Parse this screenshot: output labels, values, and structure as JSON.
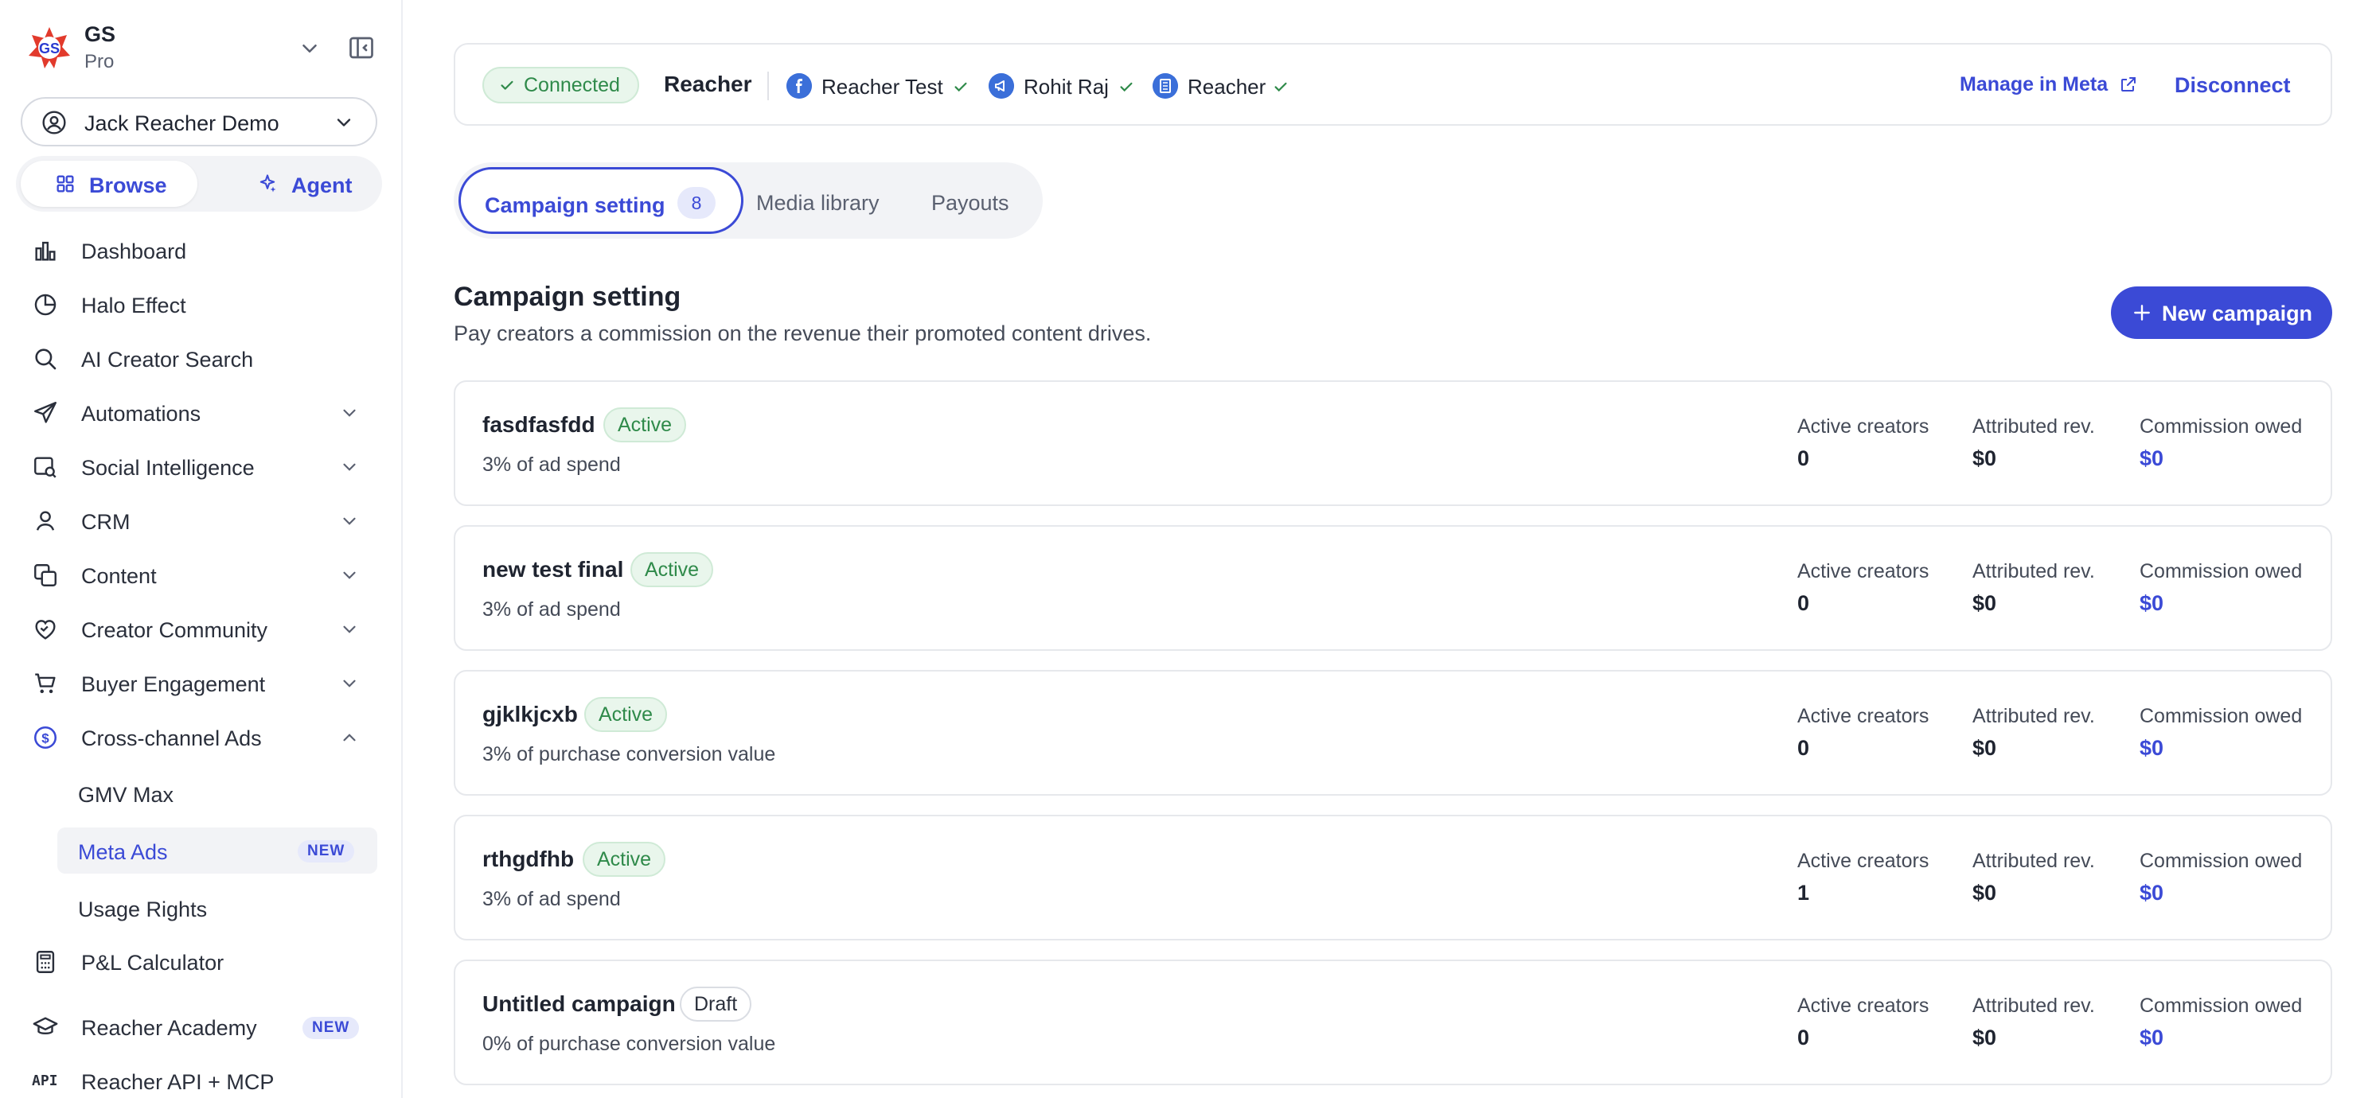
{
  "workspace": {
    "logo_text": "GS",
    "name": "GS",
    "plan": "Pro"
  },
  "user_select": {
    "label": "Jack Reacher Demo"
  },
  "mode": {
    "browse": "Browse",
    "agent": "Agent"
  },
  "nav": {
    "dashboard": "Dashboard",
    "halo": "Halo Effect",
    "ai_search": "AI Creator Search",
    "automations": "Automations",
    "social": "Social Intelligence",
    "crm": "CRM",
    "content": "Content",
    "community": "Creator Community",
    "buyer": "Buyer Engagement",
    "cross_channel": "Cross-channel Ads",
    "gmv_max": "GMV Max",
    "meta_ads": "Meta Ads",
    "usage_rights": "Usage Rights",
    "pnl": "P&L Calculator",
    "academy": "Reacher Academy",
    "api": "Reacher API + MCP",
    "api_icon_text": "API",
    "new_badge": "NEW"
  },
  "connection": {
    "status": "Connected",
    "brand": "Reacher",
    "accounts": [
      "Reacher Test",
      "Rohit Raj",
      "Reacher"
    ],
    "manage": "Manage in Meta",
    "disconnect": "Disconnect"
  },
  "tabs": {
    "campaign": "Campaign setting",
    "campaign_count": "8",
    "media": "Media library",
    "payouts": "Payouts"
  },
  "section": {
    "title": "Campaign setting",
    "subtitle": "Pay creators a commission on the revenue their promoted content drives.",
    "new_button": "New campaign"
  },
  "metric_labels": {
    "active_creators": "Active creators",
    "attributed": "Attributed rev.",
    "commission": "Commission owed"
  },
  "campaigns": [
    {
      "name": "fasdfasfdd",
      "status": "Active",
      "desc": "3% of ad spend",
      "active_creators": "0",
      "attributed": "$0",
      "commission": "$0"
    },
    {
      "name": "new test final",
      "status": "Active",
      "desc": "3% of ad spend",
      "active_creators": "0",
      "attributed": "$0",
      "commission": "$0"
    },
    {
      "name": "gjklkjcxb",
      "status": "Active",
      "desc": "3% of purchase conversion value",
      "active_creators": "0",
      "attributed": "$0",
      "commission": "$0"
    },
    {
      "name": "rthgdfhb",
      "status": "Active",
      "desc": "3% of ad spend",
      "active_creators": "1",
      "attributed": "$0",
      "commission": "$0"
    },
    {
      "name": "Untitled campaign",
      "status": "Draft",
      "desc": "0% of purchase conversion value",
      "active_creators": "0",
      "attributed": "$0",
      "commission": "$0"
    }
  ],
  "colors": {
    "accent": "#3b4ad6",
    "success_text": "#2f8a4a",
    "success_bg": "#e9f6ec",
    "logo_red": "#e23a2c",
    "logo_blue": "#2b3bd1"
  }
}
